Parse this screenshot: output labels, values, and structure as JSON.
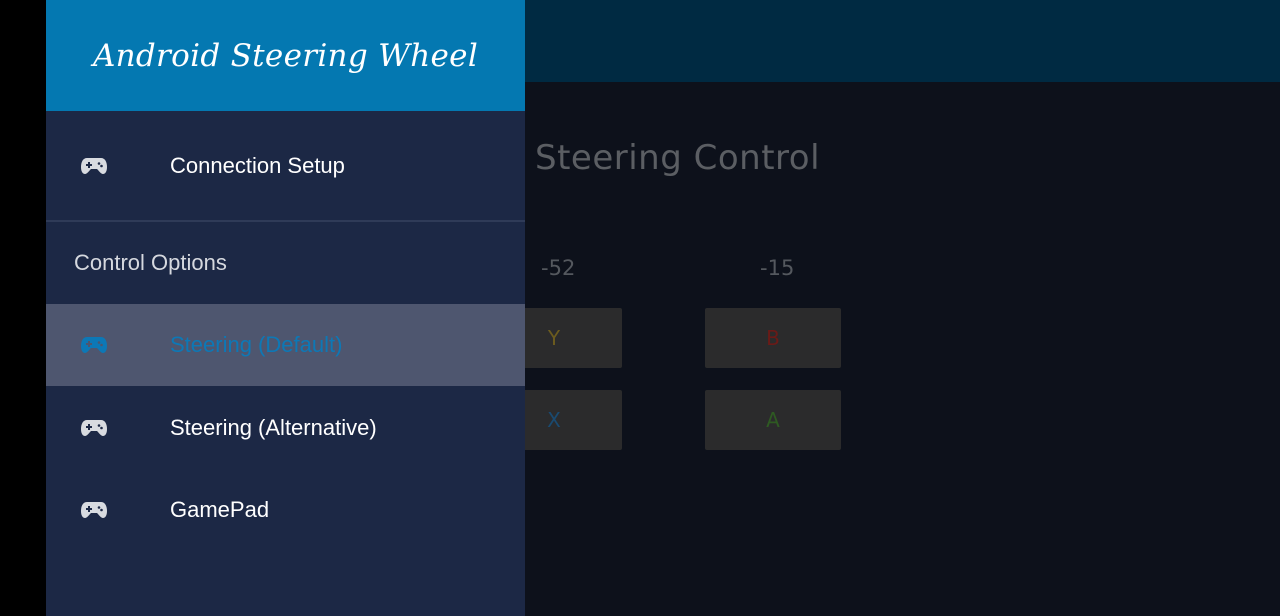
{
  "app": {
    "title": "Android Steering Wheel"
  },
  "main": {
    "title": "Steering Control",
    "values": [
      "-52",
      "-15"
    ],
    "buttons": {
      "y": "Y",
      "b": "B",
      "x": "X",
      "a": "A"
    }
  },
  "drawer": {
    "connection_label": "Connection Setup",
    "section_title": "Control Options",
    "items": [
      {
        "label": "Steering (Default)",
        "icon": "gamepad-icon",
        "selected": true
      },
      {
        "label": "Steering (Alternative)",
        "icon": "gamepad-icon",
        "selected": false
      },
      {
        "label": "GamePad",
        "icon": "gamepad-icon",
        "selected": false
      }
    ]
  },
  "colors": {
    "header": "#0478b1",
    "drawer_bg": "#1c2845",
    "selected_bg": "#4e566f",
    "selected_text": "#0d78b6",
    "app_bar": "#002a42"
  }
}
